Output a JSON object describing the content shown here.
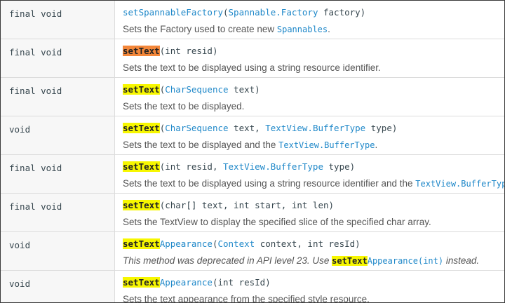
{
  "rows": [
    {
      "type": "final void",
      "sig": [
        [
          "link",
          "setSpannableFactory"
        ],
        [
          "plain",
          "("
        ],
        [
          "link",
          "Spannable.Factory"
        ],
        [
          "plain",
          " factory)"
        ]
      ],
      "desc": [
        [
          "text",
          "Sets the Factory used to create new "
        ],
        [
          "link",
          "Spannables"
        ],
        [
          "text",
          "."
        ]
      ],
      "deprecated": false
    },
    {
      "type": "final void",
      "sig": [
        [
          "hl-orange",
          "setText"
        ],
        [
          "plain",
          "(int resid)"
        ]
      ],
      "desc": [
        [
          "text",
          "Sets the text to be displayed using a string resource identifier."
        ]
      ],
      "deprecated": false
    },
    {
      "type": "final void",
      "sig": [
        [
          "hl",
          "setText"
        ],
        [
          "plain",
          "("
        ],
        [
          "link",
          "CharSequence"
        ],
        [
          "plain",
          " text)"
        ]
      ],
      "desc": [
        [
          "text",
          "Sets the text to be displayed."
        ]
      ],
      "deprecated": false
    },
    {
      "type": "void",
      "sig": [
        [
          "hl",
          "setText"
        ],
        [
          "plain",
          "("
        ],
        [
          "link",
          "CharSequence"
        ],
        [
          "plain",
          " text, "
        ],
        [
          "link",
          "TextView.BufferType"
        ],
        [
          "plain",
          " type)"
        ]
      ],
      "desc": [
        [
          "text",
          "Sets the text to be displayed and the "
        ],
        [
          "link",
          "TextView.BufferType"
        ],
        [
          "text",
          "."
        ]
      ],
      "deprecated": false
    },
    {
      "type": "final void",
      "sig": [
        [
          "hl",
          "setText"
        ],
        [
          "plain",
          "(int resid, "
        ],
        [
          "link",
          "TextView.BufferType"
        ],
        [
          "plain",
          " type)"
        ]
      ],
      "desc": [
        [
          "text",
          "Sets the text to be displayed using a string resource identifier and the "
        ],
        [
          "link",
          "TextView.BufferType"
        ]
      ],
      "deprecated": false
    },
    {
      "type": "final void",
      "sig": [
        [
          "hl",
          "setText"
        ],
        [
          "plain",
          "(char[] text, int start, int len)"
        ]
      ],
      "desc": [
        [
          "text",
          "Sets the TextView to display the specified slice of the specified char array."
        ]
      ],
      "deprecated": false
    },
    {
      "type": "void",
      "sig": [
        [
          "hl",
          "setText"
        ],
        [
          "link",
          "Appearance"
        ],
        [
          "plain",
          "("
        ],
        [
          "link",
          "Context"
        ],
        [
          "plain",
          " context, int resId)"
        ]
      ],
      "desc": [
        [
          "text",
          "This method was deprecated in API level 23. Use "
        ],
        [
          "hl",
          "setText"
        ],
        [
          "link",
          "Appearance(int)"
        ],
        [
          "text",
          " instead."
        ]
      ],
      "deprecated": true
    },
    {
      "type": "void",
      "sig": [
        [
          "hl",
          "setText"
        ],
        [
          "link",
          "Appearance"
        ],
        [
          "plain",
          "(int resId)"
        ]
      ],
      "desc": [
        [
          "text",
          "Sets the text appearance from the specified style resource."
        ]
      ],
      "deprecated": false
    }
  ]
}
